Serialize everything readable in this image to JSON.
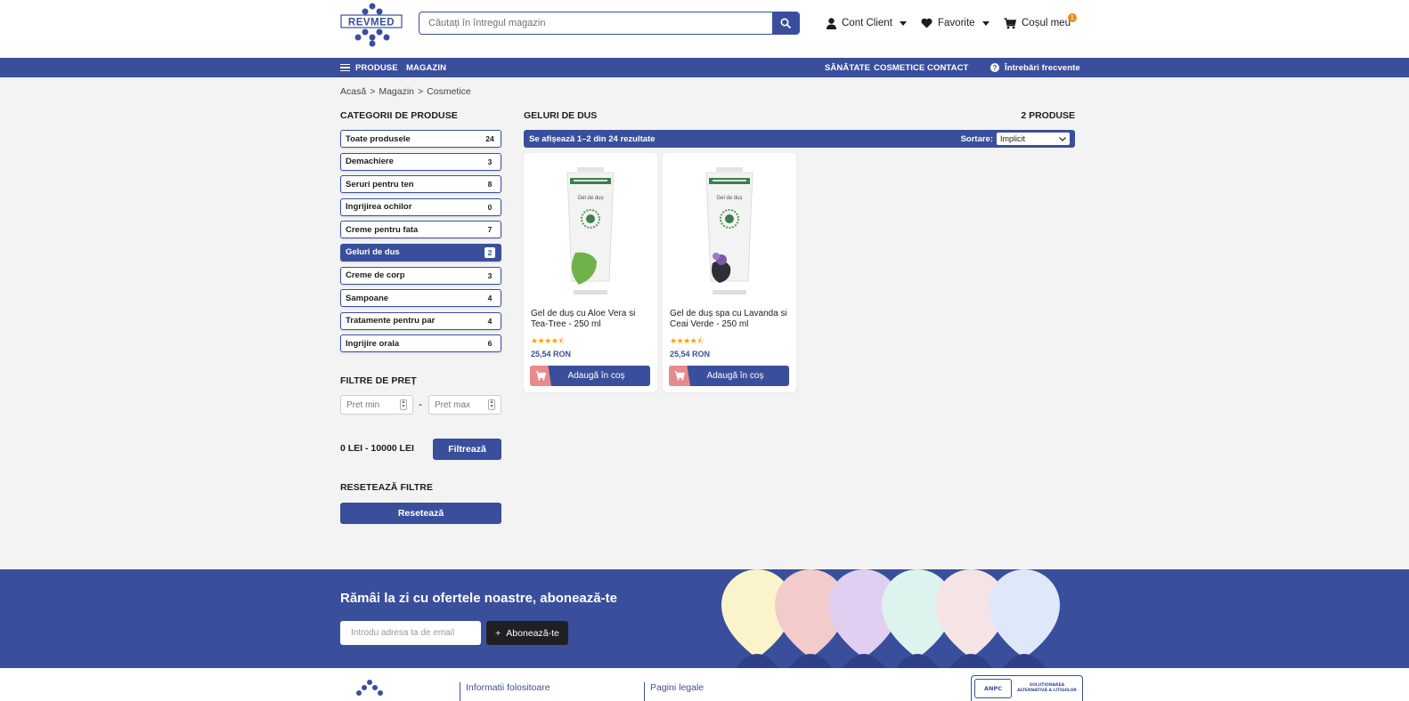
{
  "brand": {
    "logo_text": "REVMED",
    "primary": "#3a4f9c",
    "accent": "#e98a20"
  },
  "header": {
    "search_placeholder": "Căutați în întregul magazin",
    "account_label": "Cont Client",
    "favorites_label": "Favorite",
    "cart_label": "Coșul meu",
    "cart_count": "1"
  },
  "nav": {
    "products": "PRODUSE",
    "shop": "MAGAZIN",
    "health": "SĂNĂTATE",
    "cosmetics": "COSMETICE",
    "contact": "CONTACT",
    "faq": "Întrebări frecvente"
  },
  "breadcrumb": {
    "home": "Acasă",
    "sep": ">",
    "shop": "Magazin",
    "current": "Cosmetice"
  },
  "sidebar": {
    "categories_title": "CATEGORII DE PRODUSE",
    "categories": [
      {
        "label": "Toate produsele",
        "count": "24"
      },
      {
        "label": "Demachiere",
        "count": "3"
      },
      {
        "label": "Seruri pentru ten",
        "count": "8"
      },
      {
        "label": "Ingrijirea ochilor",
        "count": "0"
      },
      {
        "label": "Creme pentru fata",
        "count": "7"
      },
      {
        "label": "Geluri de dus",
        "count": "2"
      },
      {
        "label": "Creme de corp",
        "count": "3"
      },
      {
        "label": "Sampoane",
        "count": "4"
      },
      {
        "label": "Tratamente pentru par",
        "count": "4"
      },
      {
        "label": "Ingrijire orala",
        "count": "6"
      }
    ],
    "price_title": "FILTRE DE PREȚ",
    "price_min_placeholder": "Pret min",
    "price_max_placeholder": "Pret max",
    "price_dash": "-",
    "price_range": "0 LEI - 10000 LEI",
    "filter_button": "Filtrează",
    "reset_title": "RESETEAZĂ FILTRE",
    "reset_button": "Resetează"
  },
  "main": {
    "title": "GELURI DE DUS",
    "count": "2 PRODUSE",
    "results_text": "Se afișează 1–2 din 24 rezultate",
    "sort_label": "Sortare:",
    "sort_value": "Implicit",
    "products": [
      {
        "name": "Gel de duș cu Aloe Vera si Tea-Tree - 250 ml",
        "price": "25,54 RON",
        "rating": 4.5,
        "stars": "★★★★⯪",
        "add_label": "Adaugă în coș",
        "leaf_color": "#6fb24a"
      },
      {
        "name": "Gel de duș spa cu Lavanda si Ceai Verde - 250 ml",
        "price": "25,54 RON",
        "rating": 4.5,
        "stars": "★★★★⯪",
        "add_label": "Adaugă în coș",
        "leaf_color": "#5a4a78"
      }
    ]
  },
  "newsletter": {
    "title": "Rămâi la zi cu ofertele noastre, abonează-te",
    "email_placeholder": "Introdu adresa ta de email",
    "subscribe_button": "Abonează-te",
    "plus": "+"
  },
  "footer": {
    "col1": "Informatii folositoare",
    "col2": "Pagini legale",
    "anpc_short": "ANPC",
    "anpc_text": "SOLUȚIONAREA ALTERNATIVĂ A LITIGIILOR"
  }
}
